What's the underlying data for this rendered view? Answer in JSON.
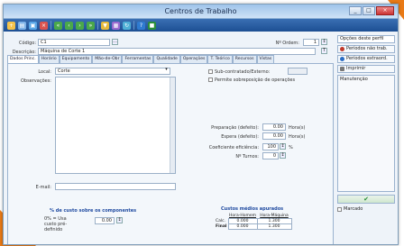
{
  "window": {
    "title": "Centros de Trabalho",
    "min": "_",
    "max": "□",
    "close": "×"
  },
  "toolbar": {
    "icons": [
      "new-icon",
      "open-icon",
      "save-icon",
      "delete-icon",
      "first-icon",
      "prev-icon",
      "next-icon",
      "last-icon",
      "filter-icon",
      "report-icon",
      "refresh-icon",
      "help-icon",
      "close-icon"
    ]
  },
  "header": {
    "codigo_label": "Código:",
    "codigo_value": "C1",
    "ordem_label": "Nº Ordem:",
    "ordem_value": "1",
    "descricao_label": "Descrição:",
    "descricao_value": "Máquina de Corte 1"
  },
  "tabs": [
    "Dados Princ.",
    "Horário",
    "Equipamento",
    "Mão-de-Obr",
    "Ferramentas",
    "Qualidade",
    "Operações",
    "T. Teórico",
    "Recursos",
    "Vistas"
  ],
  "panel": {
    "local_label": "Local:",
    "local_value": "Corte",
    "obs_label": "Observações:",
    "email_label": "E-mail:",
    "sub_label": "Sub-contratado/Externo:",
    "parente_label": "Permite sobreposição de operações",
    "prep_label": "Preparação (defeito):",
    "prep_value": "0.00",
    "prep_unit": "Hora(s)",
    "espera_label": "Espera (defeito):",
    "espera_value": "0.00",
    "espera_unit": "Hora(s)",
    "coef_label": "Coeficiente eficiência:",
    "coef_value": "100",
    "coef_unit": "%",
    "turnos_label": "Nº Turnos:",
    "turnos_value": "0",
    "pct_title": "% de custo sobre os componentes",
    "pct_label": "0% = Usa custo pré-definido",
    "pct_value": "0.00",
    "custos_title": "Custos médios apurados",
    "col1": "Hora-Homem",
    "col2": "Hora-Máquina",
    "row1_label": "Calc.",
    "row1_v1": "0.000",
    "row1_v2": "1.300",
    "row2_label": "Final",
    "row2_v1": "0.000",
    "row2_v2": "1.300"
  },
  "right": {
    "dropdown": "Opções deste perfil",
    "btn1": "Períodos não trab.",
    "btn2": "Períodos extraord.",
    "btn3": "Imprimir",
    "manut": "Manutenção",
    "marcado": "Marcado"
  }
}
